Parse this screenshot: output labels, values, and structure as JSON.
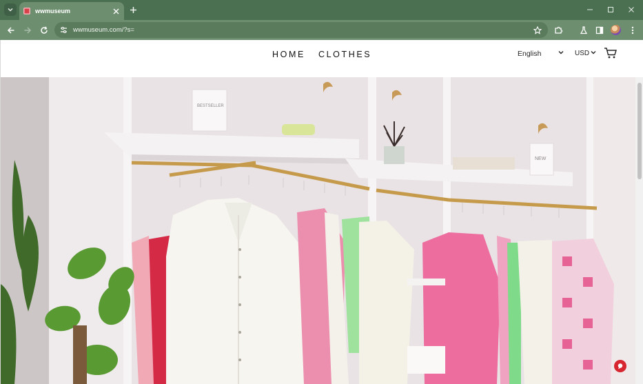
{
  "browser": {
    "tab_title": "wwmuseum",
    "url": "wwmuseum.com/?s="
  },
  "header": {
    "nav": [
      "HOME",
      "CLOTHES"
    ],
    "language": "English",
    "currency": "USD"
  },
  "hero": {
    "shelf_sign_left": "BESTSELLER",
    "shelf_sign_right": "NEW"
  },
  "colors": {
    "tabbar": "#4b6f51",
    "toolbar": "#6d8e6f",
    "accent_red": "#d7262f"
  },
  "icons": {
    "tab_menu": "chevron-down-icon",
    "tab_close": "close-icon",
    "new_tab": "plus-icon",
    "back": "arrow-left-icon",
    "forward": "arrow-right-icon",
    "reload": "reload-icon",
    "site_info": "tune-icon",
    "bookmark": "star-icon",
    "extensions": "puzzle-icon",
    "labs": "flask-icon",
    "side_panel": "side-panel-icon",
    "menu": "kebab-menu-icon",
    "cart": "cart-icon"
  }
}
